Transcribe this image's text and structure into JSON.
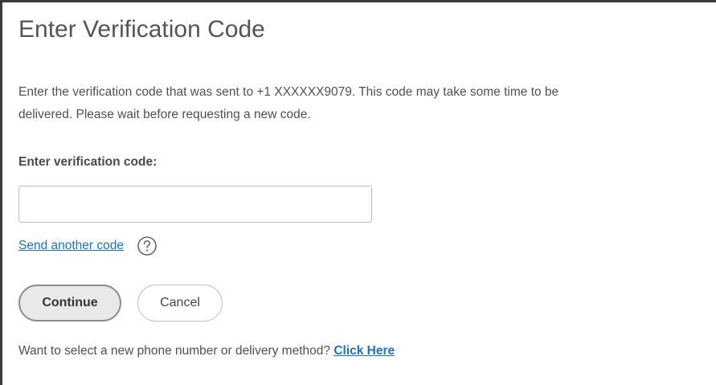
{
  "title": "Enter Verification Code",
  "description": {
    "line1": "Enter the verification code that was sent to +1 XXXXXX9079. This code may take some time to be",
    "line2": "delivered. Please wait before requesting a new code."
  },
  "code_field": {
    "label": "Enter verification code:",
    "value": "",
    "placeholder": ""
  },
  "send_another": {
    "label": "Send another code",
    "help_icon": "question-circle-icon"
  },
  "buttons": {
    "continue_label": "Continue",
    "cancel_label": "Cancel"
  },
  "footer": {
    "text": "Want to select a new phone number or delivery method?",
    "link_label": "Click Here"
  },
  "colors": {
    "link": "#1a73c8",
    "text": "#505050",
    "continue_bg": "#e9e9e9"
  }
}
